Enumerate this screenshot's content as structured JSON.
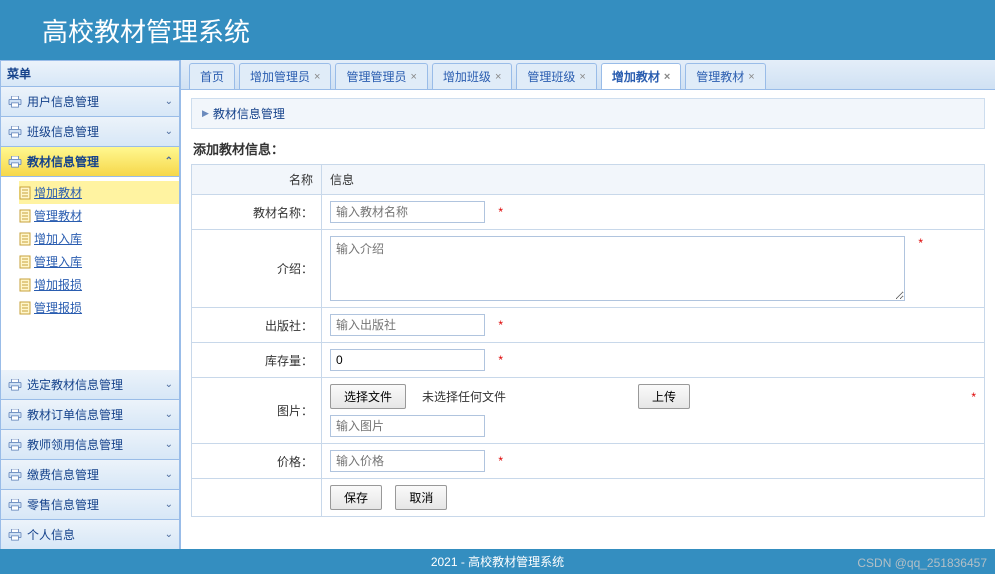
{
  "header": {
    "title": "高校教材管理系统"
  },
  "sidebar": {
    "title": "菜单",
    "items": [
      {
        "label": "用户信息管理",
        "expanded": false
      },
      {
        "label": "班级信息管理",
        "expanded": false
      },
      {
        "label": "教材信息管理",
        "expanded": true
      },
      {
        "label": "选定教材信息管理",
        "expanded": false
      },
      {
        "label": "教材订单信息管理",
        "expanded": false
      },
      {
        "label": "教师领用信息管理",
        "expanded": false
      },
      {
        "label": "缴费信息管理",
        "expanded": false
      },
      {
        "label": "零售信息管理",
        "expanded": false
      },
      {
        "label": "个人信息",
        "expanded": false
      }
    ],
    "submenu": [
      {
        "label": "增加教材",
        "highlight": true
      },
      {
        "label": "管理教材",
        "highlight": false
      },
      {
        "label": "增加入库",
        "highlight": false
      },
      {
        "label": "管理入库",
        "highlight": false
      },
      {
        "label": "增加报损",
        "highlight": false
      },
      {
        "label": "管理报损",
        "highlight": false
      }
    ]
  },
  "tabs": {
    "items": [
      {
        "label": "首页",
        "closable": false,
        "active": false
      },
      {
        "label": "增加管理员",
        "closable": true,
        "active": false
      },
      {
        "label": "管理管理员",
        "closable": true,
        "active": false
      },
      {
        "label": "增加班级",
        "closable": true,
        "active": false
      },
      {
        "label": "管理班级",
        "closable": true,
        "active": false
      },
      {
        "label": "增加教材",
        "closable": true,
        "active": true
      },
      {
        "label": "管理教材",
        "closable": true,
        "active": false
      }
    ]
  },
  "breadcrumb": {
    "text": "教材信息管理"
  },
  "form": {
    "title": "添加教材信息：",
    "header_name": "名称",
    "header_info": "信息",
    "fields": {
      "name": {
        "label": "教材名称：",
        "placeholder": "输入教材名称",
        "value": "",
        "required": "*"
      },
      "intro": {
        "label": "介绍：",
        "placeholder": "输入介绍",
        "value": "",
        "required": "*"
      },
      "publisher": {
        "label": "出版社：",
        "placeholder": "输入出版社",
        "value": "",
        "required": "*"
      },
      "stock": {
        "label": "库存量：",
        "placeholder": "",
        "value": "0",
        "required": "*"
      },
      "image": {
        "label": "图片：",
        "placeholder": "输入图片",
        "value": "",
        "choose_btn": "选择文件",
        "no_file": "未选择任何文件",
        "upload_btn": "上传",
        "required": "*"
      },
      "price": {
        "label": "价格：",
        "placeholder": "输入价格",
        "value": "",
        "required": "*"
      }
    },
    "buttons": {
      "save": "保存",
      "cancel": "取消"
    }
  },
  "footer": {
    "text": "2021 - 高校教材管理系统"
  },
  "watermark": "CSDN @qq_251836457"
}
